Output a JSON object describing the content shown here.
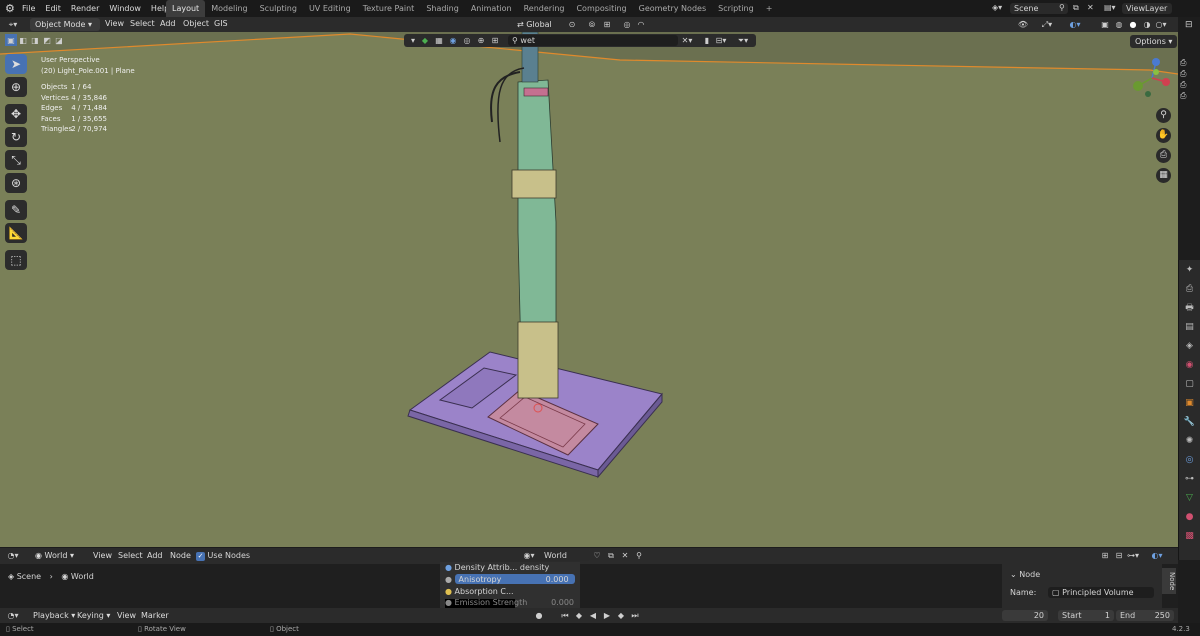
{
  "topbar": {
    "menus": [
      "File",
      "Edit",
      "Render",
      "Window",
      "Help"
    ],
    "workspaces": [
      "Layout",
      "Modeling",
      "Sculpting",
      "UV Editing",
      "Texture Paint",
      "Shading",
      "Animation",
      "Rendering",
      "Compositing",
      "Geometry Nodes",
      "Scripting"
    ],
    "active_workspace": "Layout",
    "scene": "Scene",
    "view_layer": "ViewLayer"
  },
  "viewport_header": {
    "mode": "Object Mode",
    "menus": [
      "View",
      "Select",
      "Add",
      "Object",
      "GIS"
    ],
    "orientation": "Global",
    "options": "Options",
    "search_value": "wet"
  },
  "overlay": {
    "perspective": "User Perspective",
    "object": "(20) Light_Pole.001 | Plane",
    "stats": [
      {
        "label": "Objects",
        "value": "1 / 64"
      },
      {
        "label": "Vertices",
        "value": "4 / 35,846"
      },
      {
        "label": "Edges",
        "value": "4 / 71,484"
      },
      {
        "label": "Faces",
        "value": "1 / 35,655"
      },
      {
        "label": "Triangles",
        "value": "2 / 70,974"
      }
    ]
  },
  "node_editor": {
    "world_type": "World",
    "menus": [
      "View",
      "Select",
      "Add",
      "Node"
    ],
    "use_nodes": "Use Nodes",
    "world_name": "World",
    "breadcrumb": [
      "Scene",
      "World"
    ],
    "props": [
      {
        "label": "Density Attrib...",
        "value": "density"
      },
      {
        "label": "Anisotropy",
        "value": "0.000"
      },
      {
        "label": "Absorption C...",
        "value": ""
      },
      {
        "label": "Emission Strength",
        "value": "0.000"
      }
    ],
    "panel_title": "Node",
    "panel_name_label": "Name:",
    "panel_name_value": "Principled Volume",
    "tab": "Node"
  },
  "timeline": {
    "menus": [
      "Playback",
      "Keying",
      "View",
      "Marker"
    ],
    "current_frame": "20",
    "start_label": "Start",
    "start": "1",
    "end_label": "End",
    "end": "250"
  },
  "statusbar": {
    "hints": [
      "Select",
      "Rotate View",
      "Object"
    ],
    "version": "4.2.3"
  },
  "colors": {
    "accent": "#4772b3",
    "viewport_bg": "#7a8058",
    "selected_outline": "#e08a2c"
  }
}
